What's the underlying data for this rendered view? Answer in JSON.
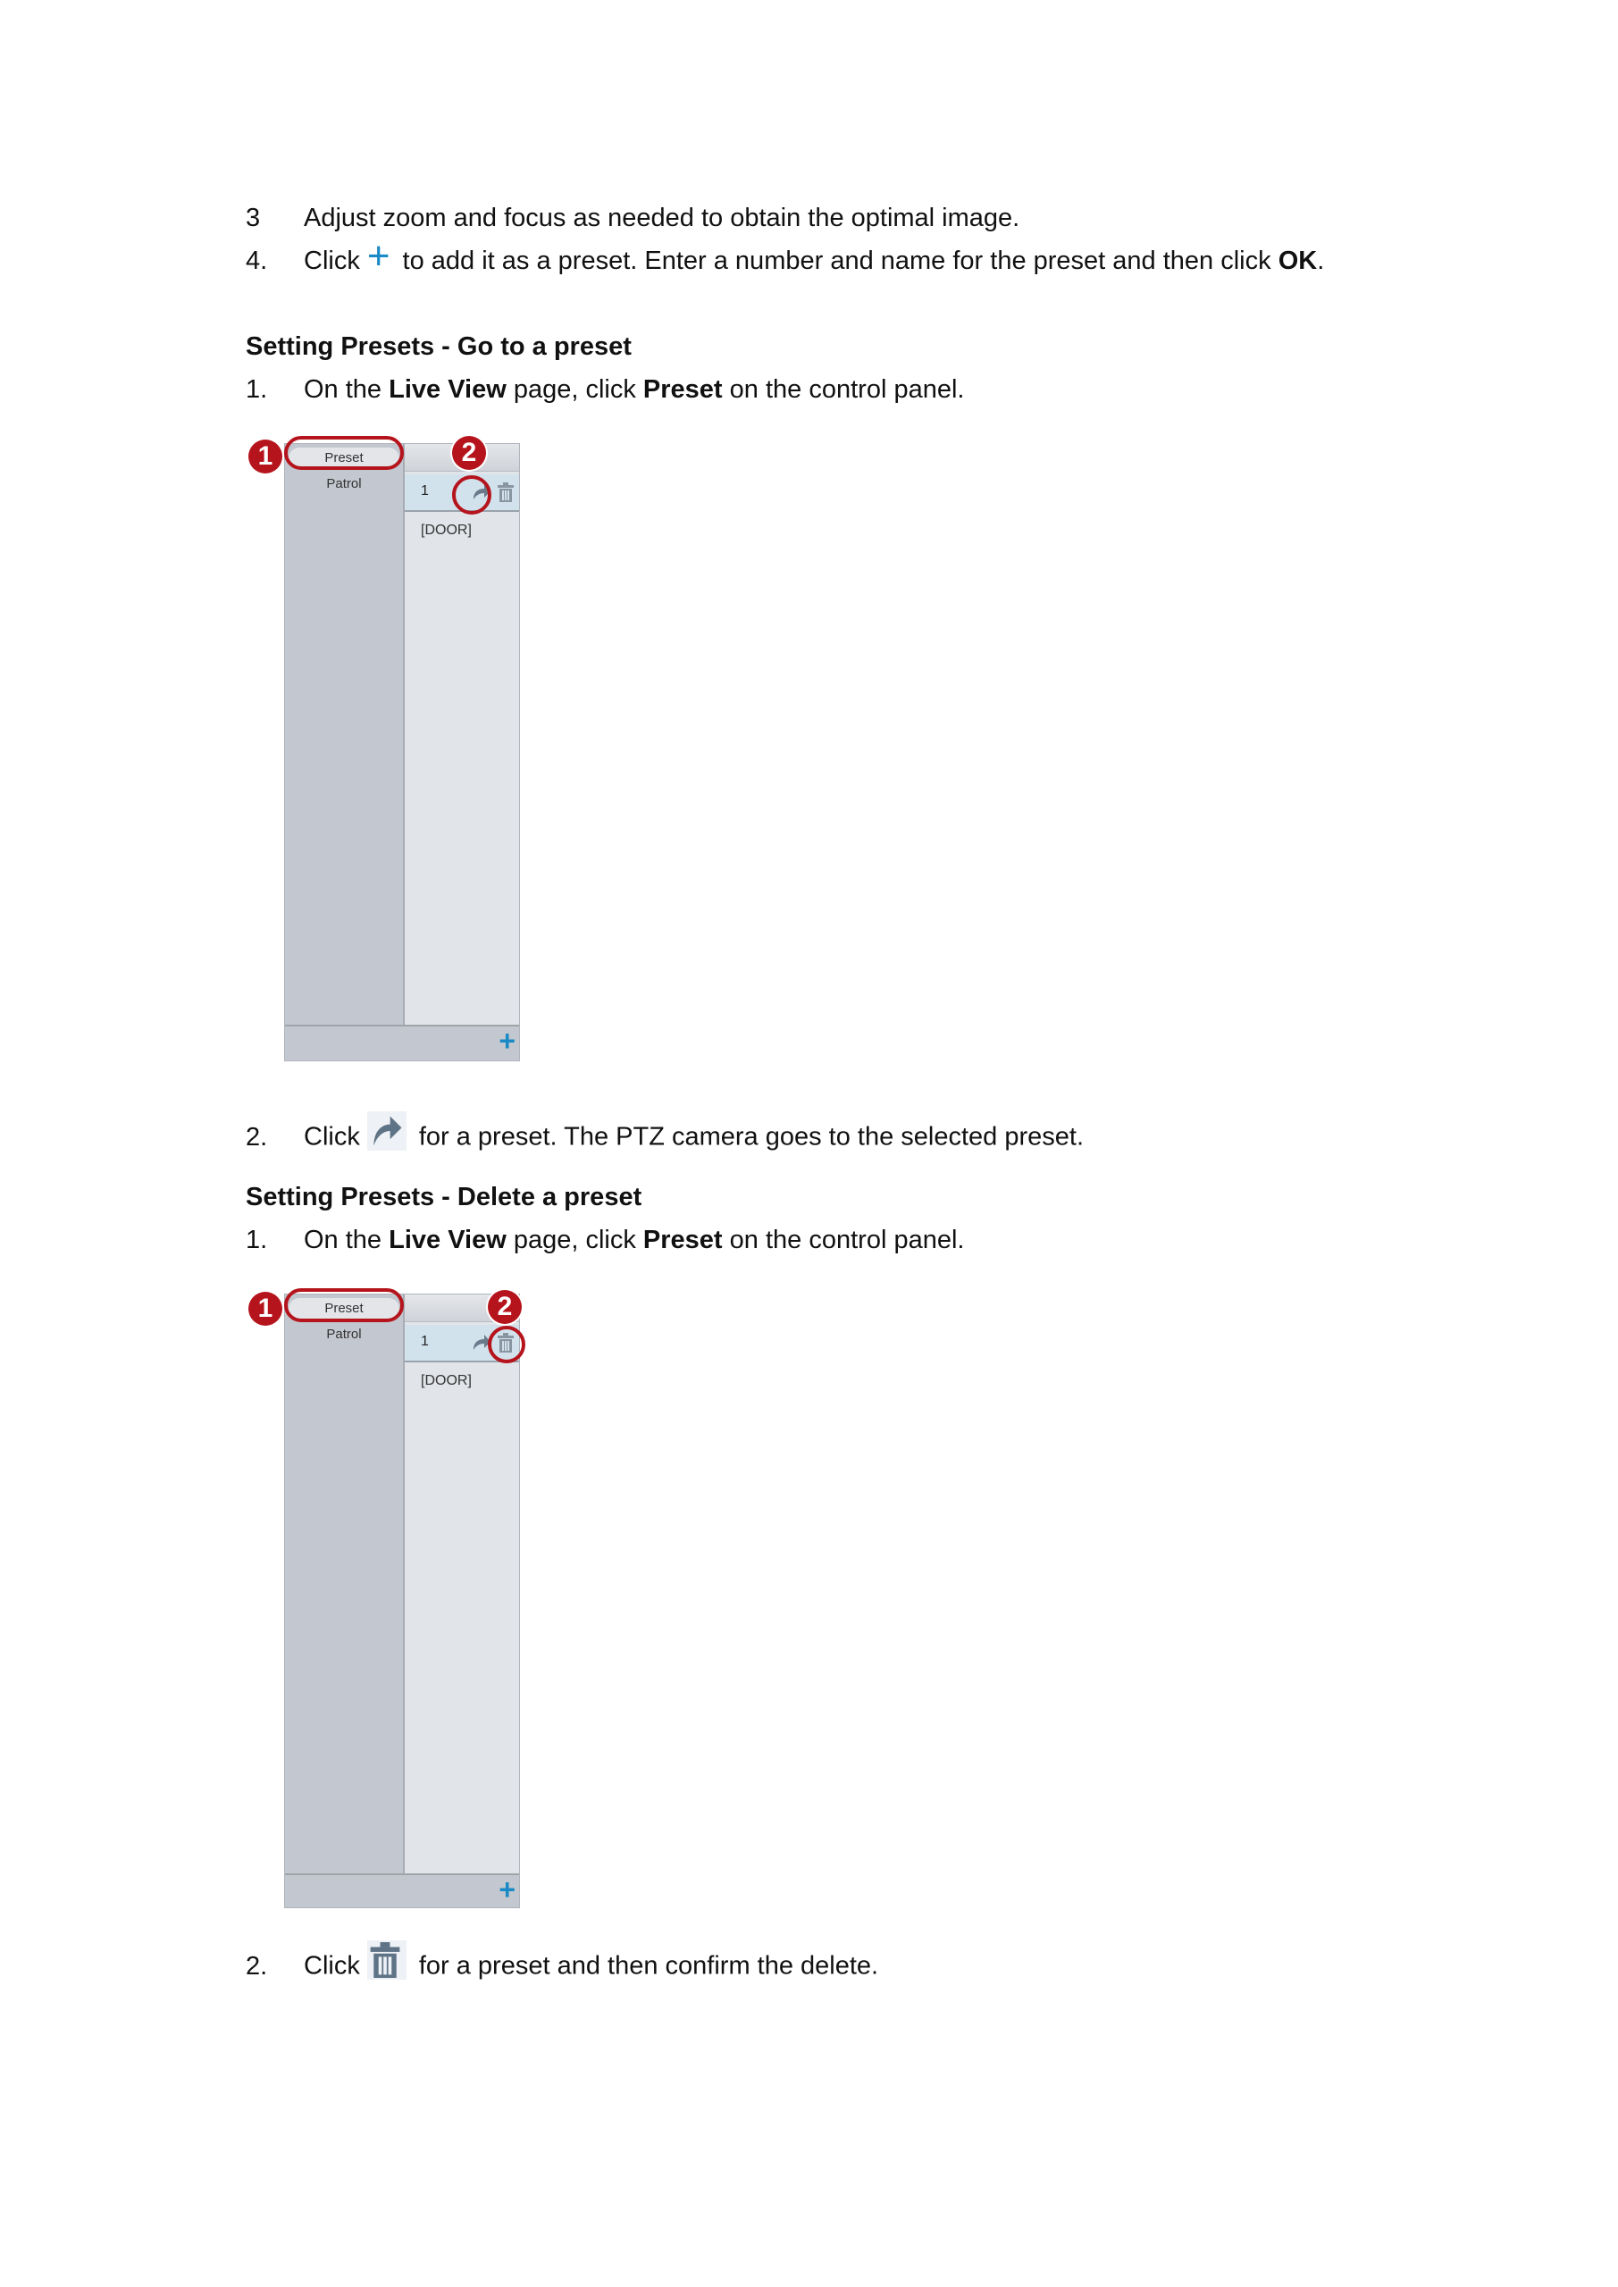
{
  "steps_top": [
    {
      "num": "3",
      "text": "Adjust zoom and focus as needed to obtain the optimal image."
    },
    {
      "num": "4.",
      "before": "Click",
      "icon": "plus-icon",
      "after": "to add it as a preset. Enter a number and name for the preset and then click",
      "bold_end": "OK",
      "end": "."
    }
  ],
  "section_goto": {
    "heading": "Setting Presets - Go to a preset",
    "step1": {
      "num": "1.",
      "p1": "On the",
      "b1": "Live View",
      "p2": "page, click",
      "b2": "Preset",
      "p3": "on the control panel."
    },
    "step2": {
      "num": "2.",
      "before": "Click",
      "icon": "go-to-preset-icon",
      "after": "for a preset. The PTZ camera goes to the selected preset."
    }
  },
  "section_delete": {
    "heading": "Setting Presets - Delete a preset",
    "step1": {
      "num": "1.",
      "p1": "On the",
      "b1": "Live View",
      "p2": "page, click",
      "b2": "Preset",
      "p3": "on the control panel."
    },
    "step2": {
      "num": "2.",
      "before": "Click",
      "icon": "trash-icon",
      "after": "for a preset and then confirm the delete."
    }
  },
  "panel": {
    "tabs": [
      "Preset",
      "Patrol"
    ],
    "preset_number": "1",
    "preset_name": "[DOOR]",
    "add_symbol": "+"
  },
  "callouts": [
    "1",
    "2"
  ],
  "colors": {
    "accent_blue": "#1a8ac6",
    "callout_red": "#b5141c",
    "icon_gray": "#6b7a8a"
  }
}
